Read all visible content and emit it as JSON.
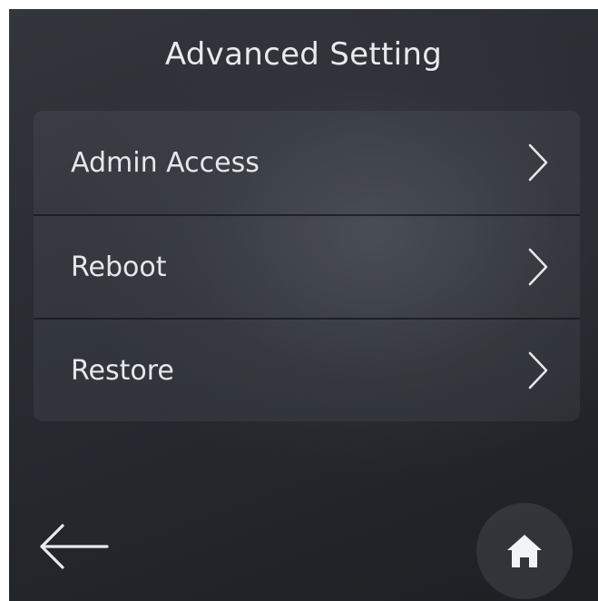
{
  "header": {
    "title": "Advanced Setting"
  },
  "menu": {
    "items": [
      {
        "label": "Admin Access",
        "icon": "chevron-right-icon"
      },
      {
        "label": "Reboot",
        "icon": "chevron-right-icon"
      },
      {
        "label": "Restore",
        "icon": "chevron-right-icon"
      }
    ]
  },
  "footer": {
    "back_icon": "arrow-left-icon",
    "home_icon": "home-icon"
  },
  "colors": {
    "background_top": "#33363c",
    "background_bottom": "#1d1f23",
    "text": "#e6e7ea",
    "panel": "rgba(150,155,165,0.10)"
  }
}
